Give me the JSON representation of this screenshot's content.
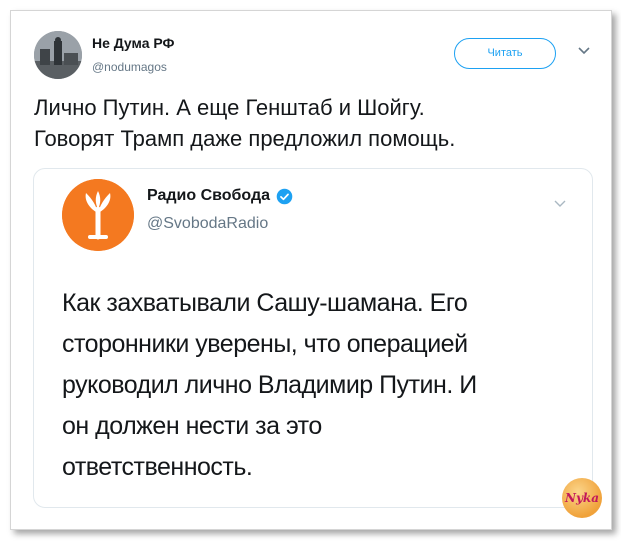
{
  "tweet": {
    "author_name": "Не Дума РФ",
    "author_handle": "@nodumagos",
    "follow_label": "Читать",
    "text_lines": [
      "Лично Путин. А еще Генштаб и Шойгу.",
      "Говорят Трамп даже предложил помощь."
    ]
  },
  "quoted": {
    "author_name": "Радио Свобода",
    "author_handle": "@SvobodaRadio",
    "verified": true,
    "text_lines": [
      "Как захватывали Сашу-шамана. Его",
      "сторонники уверены, что операцией",
      "руководил лично Владимир Путин. И",
      "он должен нести за это",
      "ответственность."
    ]
  },
  "colors": {
    "accent": "#1da1f2",
    "secondary_text": "#657786",
    "radio_logo": "#f47920"
  },
  "icons": {
    "more": "chevron-down-icon",
    "verified": "verified-badge-icon"
  }
}
